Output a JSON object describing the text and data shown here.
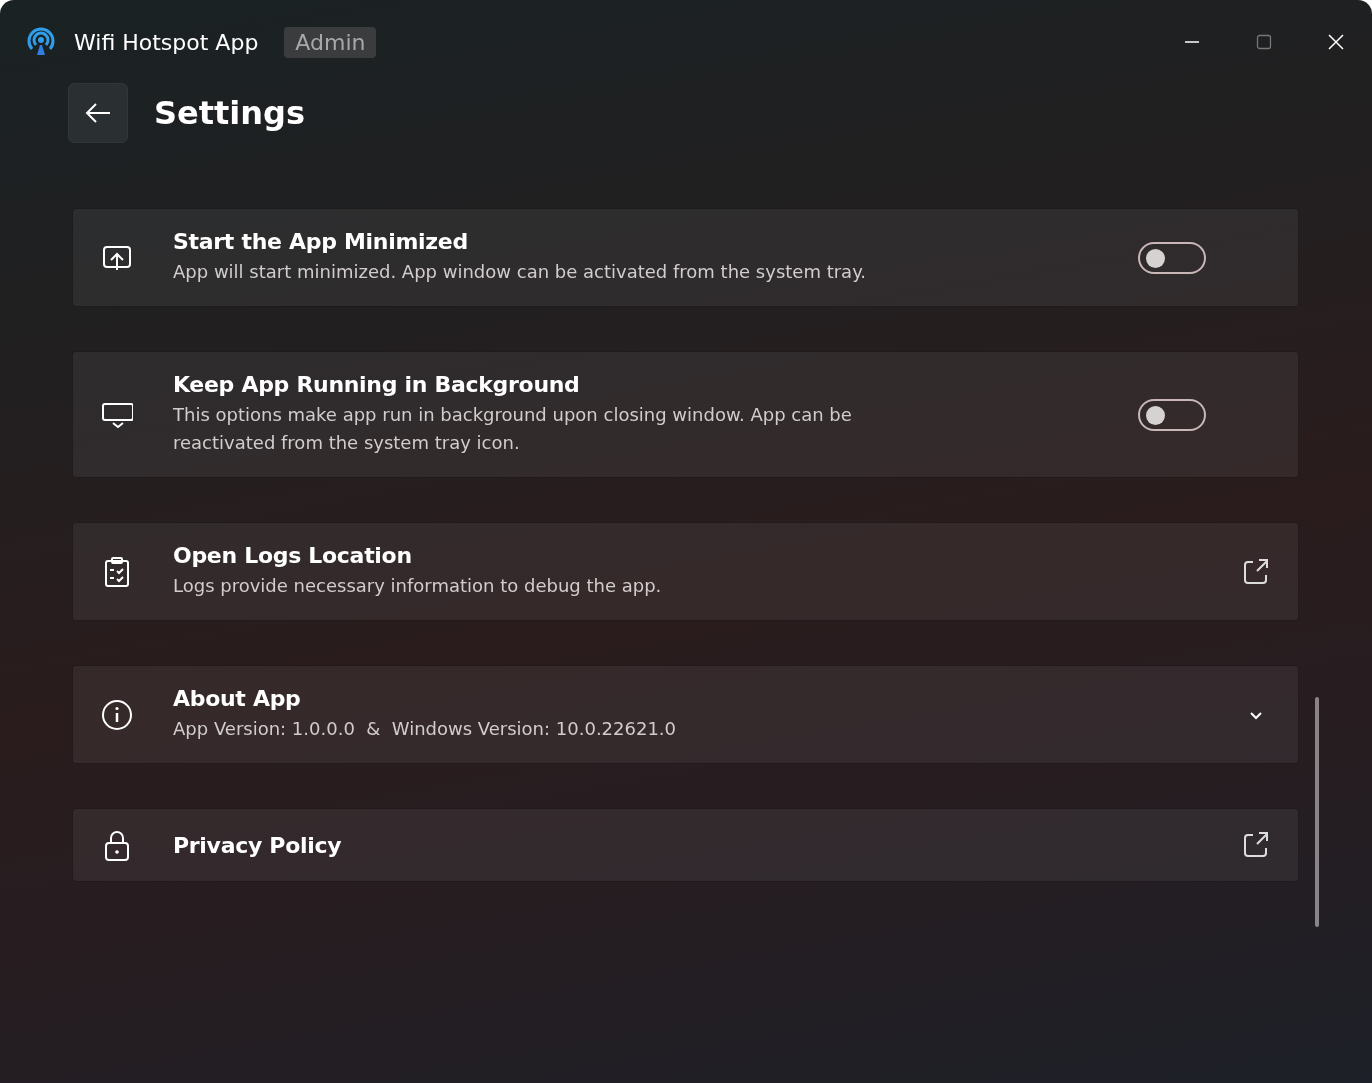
{
  "window": {
    "title": "Wifi Hotspot App",
    "badge": "Admin"
  },
  "page": {
    "title": "Settings"
  },
  "settings": [
    {
      "kind": "toggle",
      "title": "Start the App Minimized",
      "description": "App will start minimized. App window can be activated from the system tray.",
      "on": false
    },
    {
      "kind": "toggle",
      "title": "Keep App Running in Background",
      "description": "This options make app run in background upon closing window. App can be reactivated from the system tray icon.",
      "on": false
    },
    {
      "kind": "link",
      "title": "Open Logs Location",
      "description": "Logs provide necessary information to debug the app."
    },
    {
      "kind": "expander",
      "title": "About App",
      "description": "App Version: 1.0.0.0  &  Windows Version: 10.0.22621.0",
      "expanded": false
    },
    {
      "kind": "link",
      "title": "Privacy Policy"
    }
  ]
}
